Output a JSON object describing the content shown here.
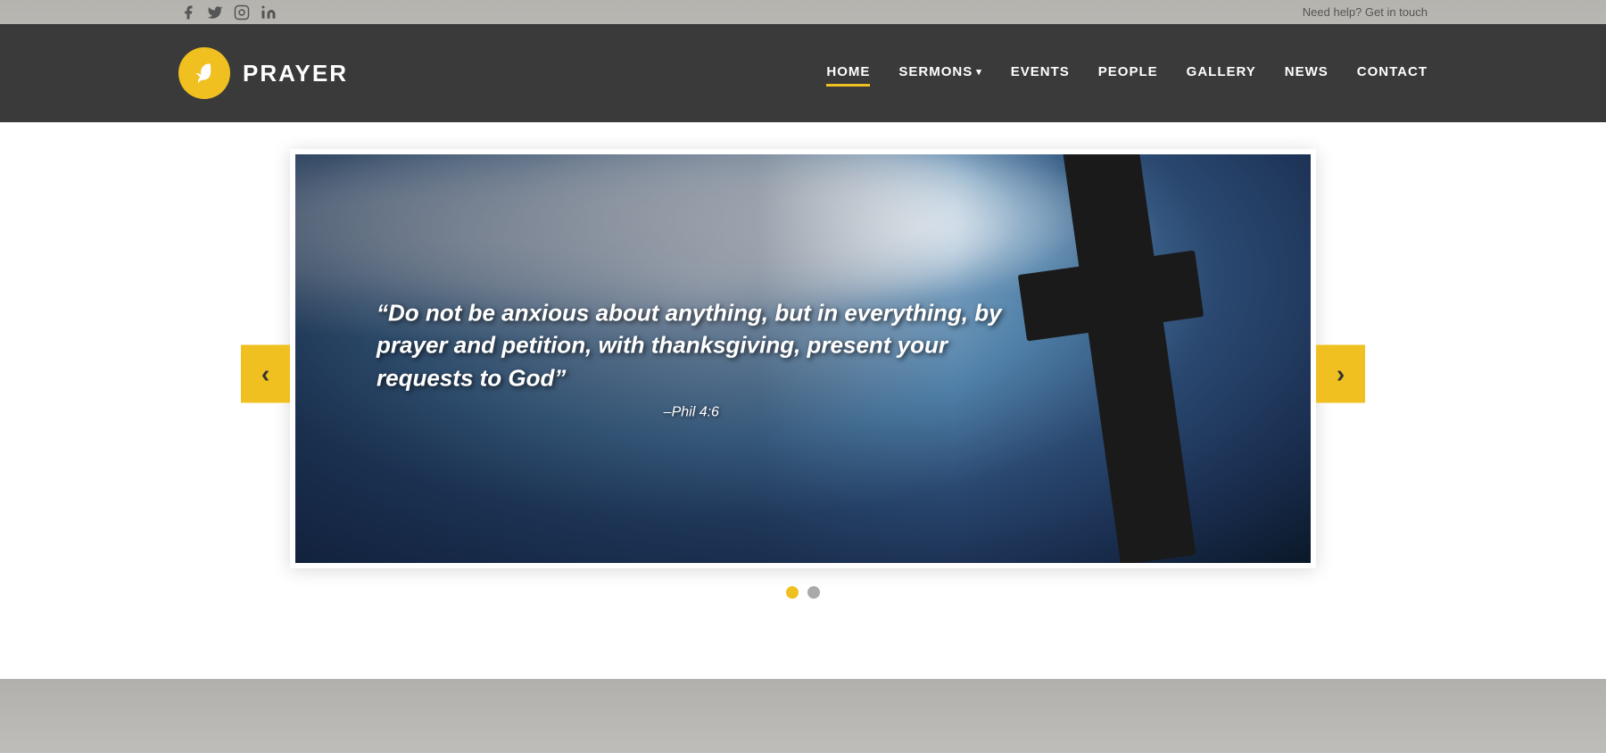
{
  "topbar": {
    "help_text": "Need help? Get in touch",
    "social": [
      {
        "name": "facebook",
        "icon": "f"
      },
      {
        "name": "twitter",
        "icon": "t"
      },
      {
        "name": "instagram",
        "icon": "i"
      },
      {
        "name": "linkedin",
        "icon": "in"
      }
    ]
  },
  "header": {
    "logo_text": "PRAYER",
    "nav_items": [
      {
        "label": "HOME",
        "active": true,
        "has_arrow": false
      },
      {
        "label": "SERMONS",
        "active": false,
        "has_arrow": true
      },
      {
        "label": "EVENTS",
        "active": false,
        "has_arrow": false
      },
      {
        "label": "PEOPLE",
        "active": false,
        "has_arrow": false
      },
      {
        "label": "GALLERY",
        "active": false,
        "has_arrow": false
      },
      {
        "label": "NEWS",
        "active": false,
        "has_arrow": false
      },
      {
        "label": "CONTACT",
        "active": false,
        "has_arrow": false
      }
    ]
  },
  "slide": {
    "quote": "“Do not be anxious about anything, but in everything, by prayer and petition, with thanksgiving, present your requests to God”",
    "reference": "–Phil 4:6",
    "prev_label": "‹",
    "next_label": "›"
  },
  "dots": [
    {
      "active": true
    },
    {
      "active": false
    }
  ],
  "colors": {
    "accent": "#f0c020",
    "header_bg": "#3a3a3a",
    "nav_active_underline": "#f0c020"
  }
}
